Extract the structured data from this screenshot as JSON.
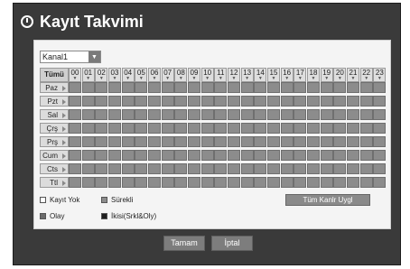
{
  "title": "Kayıt Takvimi",
  "channel_select": {
    "value": "Kanal1"
  },
  "grid": {
    "all_label": "Tümü",
    "hours": [
      "00",
      "01",
      "02",
      "03",
      "04",
      "05",
      "06",
      "07",
      "08",
      "09",
      "10",
      "11",
      "12",
      "13",
      "14",
      "15",
      "16",
      "17",
      "18",
      "19",
      "20",
      "21",
      "22",
      "23"
    ],
    "days": [
      "Paz",
      "Pzt",
      "Sal",
      "Çrş",
      "Prş",
      "Cum",
      "Cts",
      "Ttl"
    ],
    "cell_mode": "Sürekli"
  },
  "legend": {
    "no_record": "Kayıt Yok",
    "continuous": "Sürekli",
    "event": "Olay",
    "both": "İkisi(Srkl&Oly)"
  },
  "colors": {
    "no_record": "#ffffff",
    "continuous": "#8c8c8c",
    "event": "#6b6b6b",
    "both": "#1f1f1f"
  },
  "buttons": {
    "apply_all": "Tüm Kanlr Uygl",
    "ok": "Tamam",
    "cancel": "İptal"
  }
}
